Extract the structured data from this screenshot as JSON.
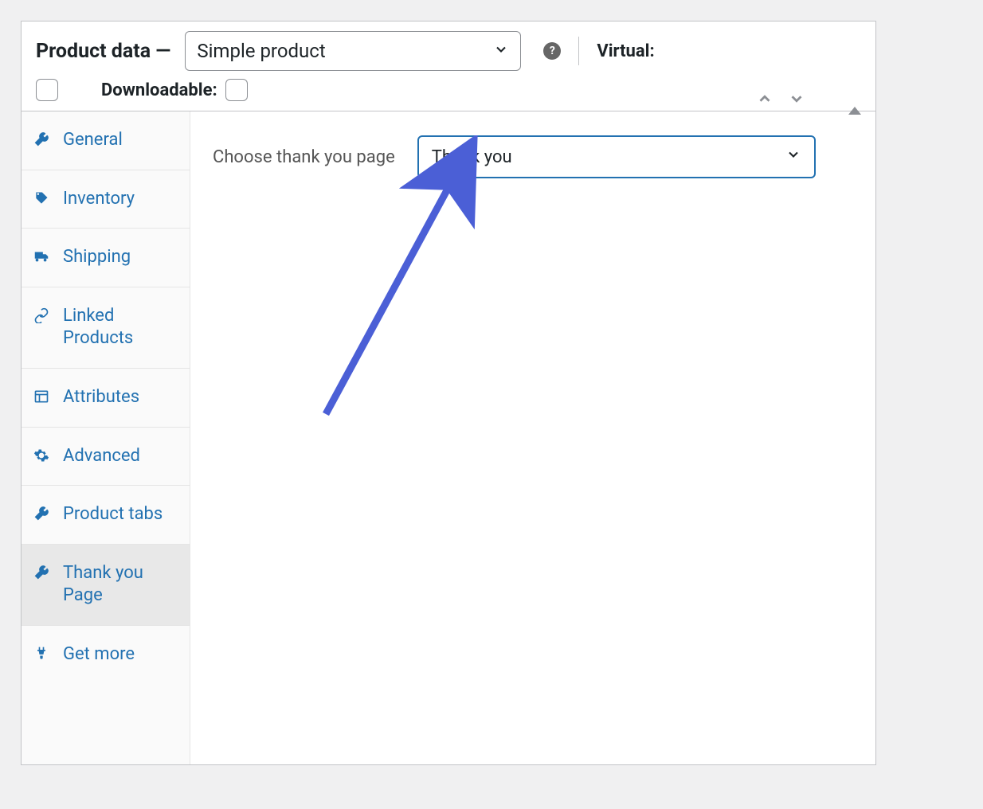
{
  "header": {
    "title": "Product data —",
    "product_type": "Simple product",
    "virtual_label": "Virtual:",
    "downloadable_label": "Downloadable:"
  },
  "sidebar": {
    "items": [
      {
        "icon": "wrench",
        "label": "General"
      },
      {
        "icon": "tag",
        "label": "Inventory"
      },
      {
        "icon": "truck",
        "label": "Shipping"
      },
      {
        "icon": "link",
        "label": "Linked Products"
      },
      {
        "icon": "list",
        "label": "Attributes"
      },
      {
        "icon": "gear",
        "label": "Advanced"
      },
      {
        "icon": "wrench",
        "label": "Product tabs"
      },
      {
        "icon": "wrench",
        "label": "Thank you Page"
      },
      {
        "icon": "plug",
        "label": "Get more"
      }
    ],
    "active_index": 7
  },
  "content": {
    "field_label": "Choose thank you page",
    "selected_value": "Thank you"
  }
}
